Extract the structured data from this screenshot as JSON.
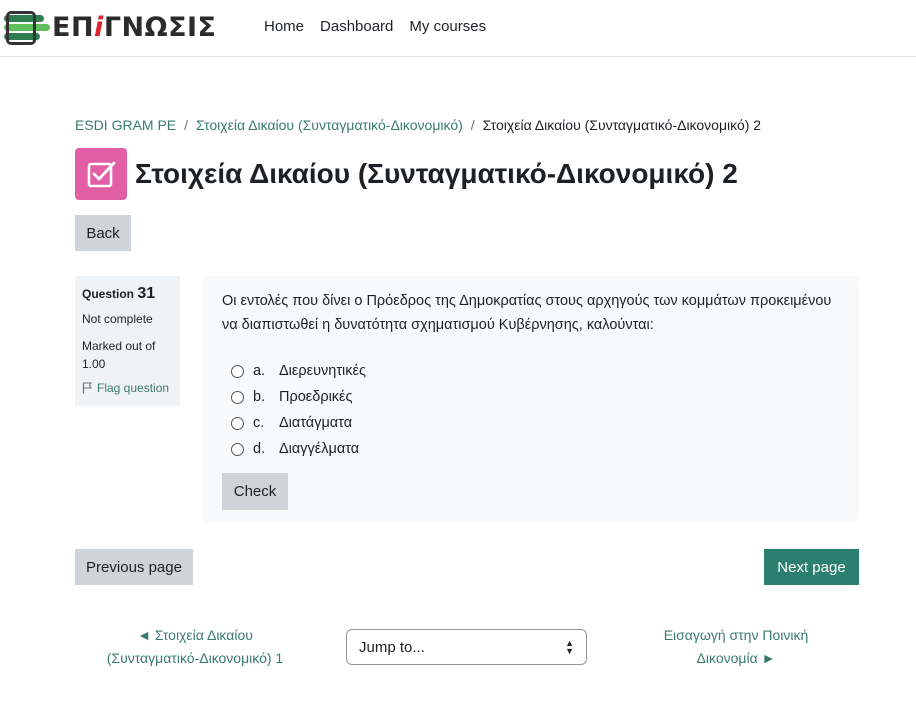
{
  "brand": {
    "logo_prefix": "ΕΠ",
    "logo_accent": "i",
    "logo_suffix": "ΓΝΩΣΙΣ"
  },
  "nav": {
    "home": "Home",
    "dashboard": "Dashboard",
    "my_courses": "My courses"
  },
  "breadcrumb": {
    "items": [
      "ESDI GRAM PE",
      "Στοιχεία Δικαίου (Συνταγματικό-Δικονομικό)"
    ],
    "current": "Στοιχεία Δικαίου (Συνταγματικό-Δικονομικό) 2"
  },
  "page": {
    "title": "Στοιχεία Δικαίου (Συνταγματικό-Δικονομικό) 2",
    "back_label": "Back"
  },
  "question": {
    "label": "Question",
    "number": "31",
    "state": "Not complete",
    "grade_line1": "Marked out of",
    "grade_line2": "1.00",
    "flag_label": "Flag question",
    "text": "Οι εντολές που δίνει ο Πρόεδρος της Δημοκρατίας στους αρχηγούς των κομμάτων προκειμένου να διαπιστωθεί η δυνατότητα σχηματισμού Κυβέρνησης, καλούνται:",
    "answers": [
      {
        "letter": "a.",
        "text": "Διερευνητικές"
      },
      {
        "letter": "b.",
        "text": "Προεδρικές"
      },
      {
        "letter": "c.",
        "text": "Διατάγματα"
      },
      {
        "letter": "d.",
        "text": "Διαγγέλματα"
      }
    ],
    "check_label": "Check"
  },
  "paging": {
    "previous_label": "Previous page",
    "next_label": "Next page"
  },
  "activity_nav": {
    "prev_line1": "◄ Στοιχεία Δικαίου",
    "prev_line2": "(Συνταγματικό-Δικονομικό) 1",
    "jump_placeholder": "Jump to...",
    "next_line1": "Εισαγωγή στην Ποινική",
    "next_line2": "Δικονομία ►"
  },
  "colors": {
    "primary": "#2b7f6e",
    "link": "#3a7a6e",
    "quiz_icon_bg": "#e25ea5",
    "secondary_button": "#ced4da"
  },
  "icons": {
    "quiz": "quiz-checkbox-icon",
    "flag": "flag-icon",
    "select": "select-arrows-icon"
  }
}
